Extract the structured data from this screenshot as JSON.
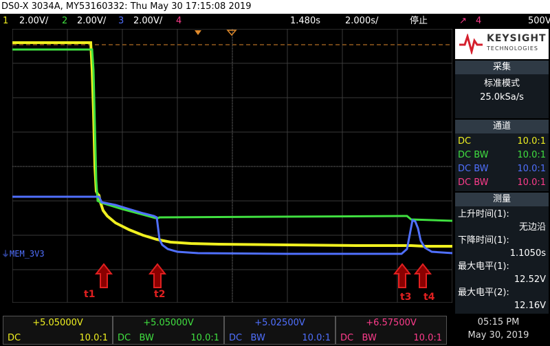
{
  "title": "DS0-X 3034A, MY53160332: Thu May 30 17:15:08 2019",
  "channels": [
    {
      "num": "1",
      "scale": "2.00V/",
      "color": "#f0f020"
    },
    {
      "num": "2",
      "scale": "2.00V/",
      "color": "#40e040"
    },
    {
      "num": "3",
      "scale": "2.00V/",
      "color": "#5070ff"
    },
    {
      "num": "4",
      "scale": "",
      "color": "#ff3c8c"
    }
  ],
  "timebase": {
    "delay": "1.480s",
    "scale": "2.000s/",
    "run_state": "停止"
  },
  "trigger_status": {
    "edge_icon": "rising-edge-icon",
    "channel": "4",
    "level": "500V"
  },
  "brand": {
    "name": "KEYSIGHT",
    "sub": "TECHNOLOGIES"
  },
  "acquire": {
    "header": "采集",
    "mode": "标准模式",
    "rate": "25.0kSa/s"
  },
  "channels_panel": {
    "header": "通道",
    "rows": [
      {
        "coupling": "DC",
        "probe": "10.0:1",
        "color": "#f0f020"
      },
      {
        "coupling": "DC BW",
        "probe": "10.0:1",
        "color": "#40e040"
      },
      {
        "coupling": "DC BW",
        "probe": "10.0:1",
        "color": "#5070ff"
      },
      {
        "coupling": "DC BW",
        "probe": "10.0:1",
        "color": "#ff3c8c"
      }
    ]
  },
  "measure": {
    "header": "测量",
    "items": [
      {
        "label": "上升时间(1):",
        "value": "无边沿"
      },
      {
        "label": "下降时间(1):",
        "value": "1.1050s"
      },
      {
        "label": "最大电平(1):",
        "value": "12.52V"
      },
      {
        "label": "最大电平(2):",
        "value": "12.16V"
      }
    ]
  },
  "waveform_label": "MEM_3V3",
  "markers": [
    "t1",
    "t2",
    "t3",
    "t4"
  ],
  "bottom": {
    "ch1": {
      "offset": "+5.05000V",
      "coupling": "DC",
      "bw": "",
      "probe": "10.0:1"
    },
    "ch2": {
      "offset": "+5.05000V",
      "coupling": "DC",
      "bw": "BW",
      "probe": "10.0:1"
    },
    "ch3": {
      "offset": "+5.02500V",
      "coupling": "DC",
      "bw": "BW",
      "probe": "10.0:1"
    },
    "ch4": {
      "offset": "+6.57500V",
      "coupling": "DC",
      "bw": "BW",
      "probe": "10.0:1"
    },
    "time": "05:15 PM",
    "date": "May 30, 2019"
  }
}
